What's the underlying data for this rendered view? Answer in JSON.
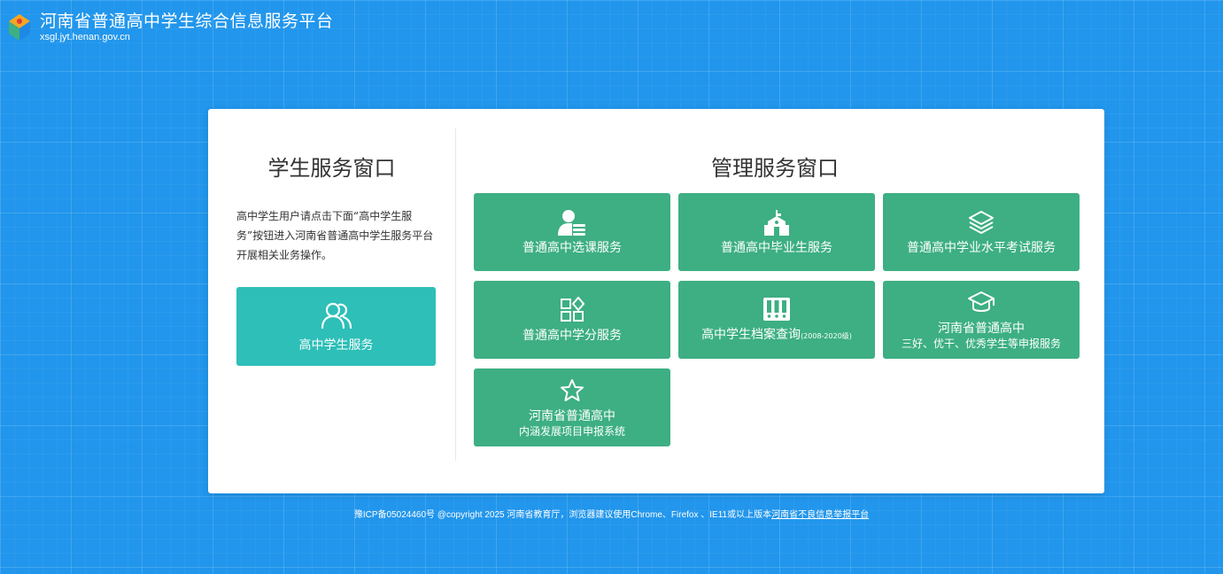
{
  "header": {
    "title": "河南省普通高中学生综合信息服务平台",
    "url": "xsgl.jyt.henan.gov.cn"
  },
  "left": {
    "title": "学生服务窗口",
    "description": "高中学生用户请点击下面“高中学生服务”按钮进入河南省普通高中学生服务平台开展相关业务操作。",
    "button_label": "高中学生服务"
  },
  "right": {
    "title": "管理服务窗口",
    "services": [
      {
        "label": "普通高中选课服务",
        "icon": "user-card-icon"
      },
      {
        "label": "普通高中毕业生服务",
        "icon": "school-building-icon"
      },
      {
        "label": "普通高中学业水平考试服务",
        "icon": "layers-icon"
      },
      {
        "label": "普通高中学分服务",
        "icon": "grid-diamond-icon"
      },
      {
        "label": "高中学生档案查询",
        "label_suffix": "(2008-2020级)",
        "icon": "archive-icon"
      },
      {
        "label": "河南省普通高中",
        "sub": "三好、优干、优秀学生等申报服务",
        "icon": "graduation-cap-icon"
      },
      {
        "label": "河南省普通高中",
        "sub": "内涵发展项目申报系统",
        "icon": "star-icon"
      }
    ]
  },
  "footer": {
    "text": "豫ICP备05024460号 @copyright 2025 河南省教育厅，浏览器建议使用Chrome、Firefox 、IE11或以上版本",
    "link": "河南省不良信息举报平台"
  },
  "colors": {
    "background": "#2196ec",
    "student_button": "#2dbfb8",
    "service_button": "#3daf83"
  }
}
